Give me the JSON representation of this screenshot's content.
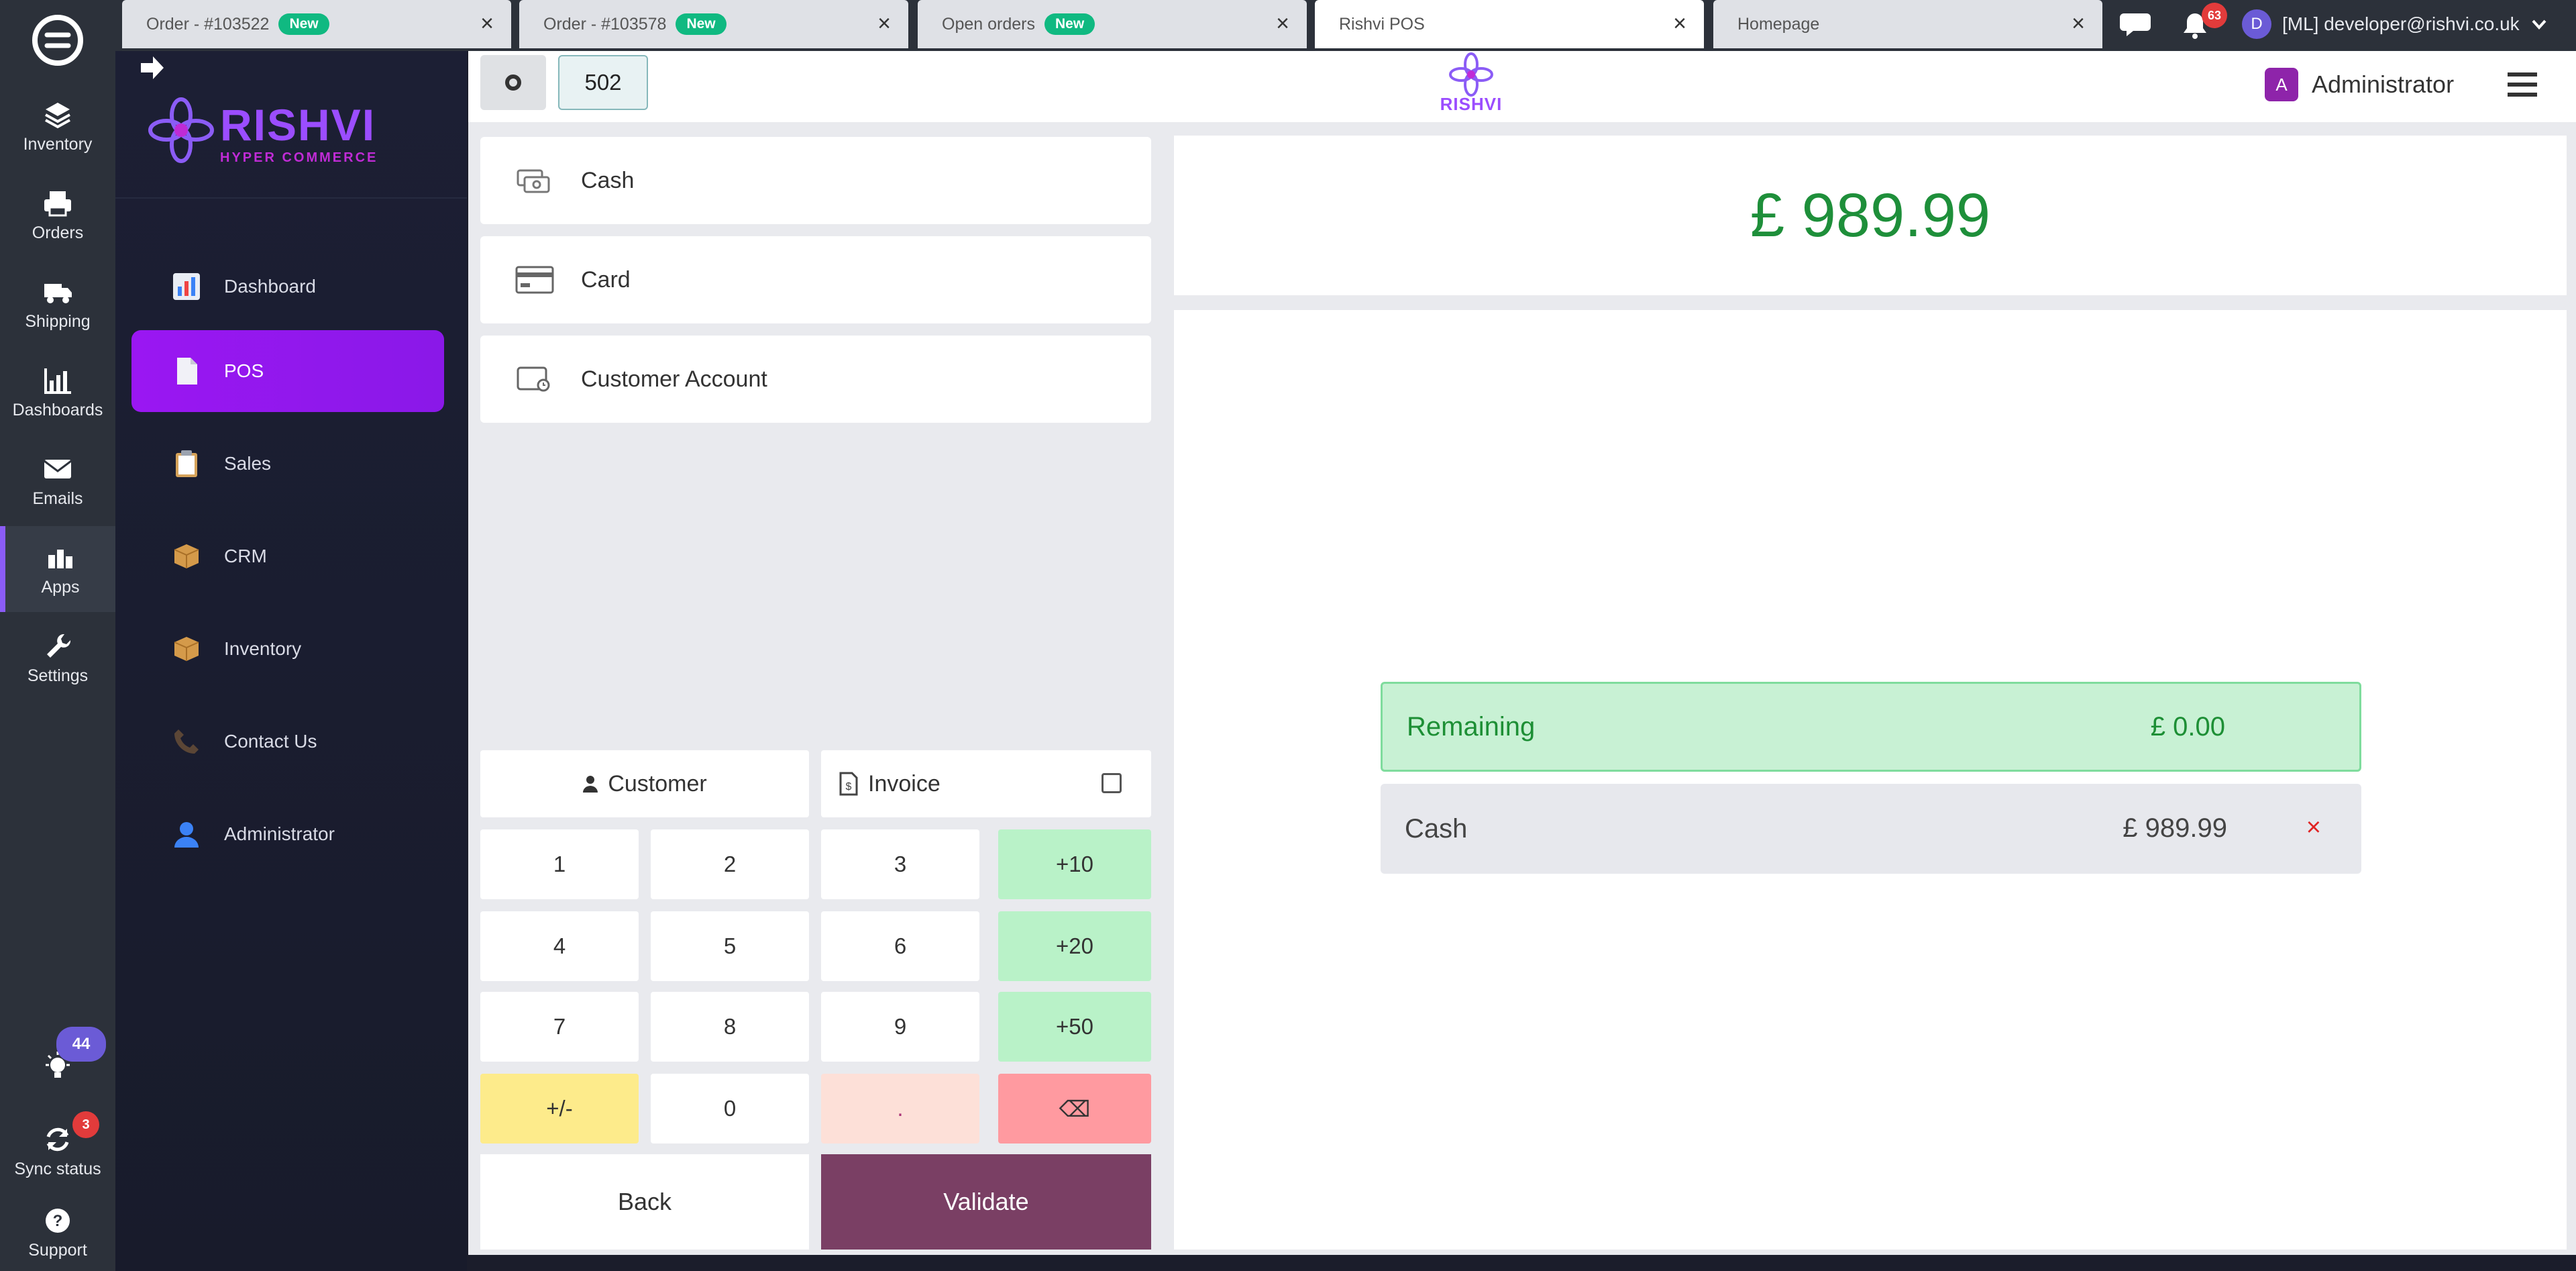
{
  "rail": {
    "items": [
      {
        "label": "Inventory",
        "icon": "layers-icon"
      },
      {
        "label": "Orders",
        "icon": "printer-icon"
      },
      {
        "label": "Shipping",
        "icon": "truck-icon"
      },
      {
        "label": "Dashboards",
        "icon": "bar-chart-icon"
      },
      {
        "label": "Emails",
        "icon": "envelope-icon"
      },
      {
        "label": "Apps",
        "icon": "apps-icon"
      },
      {
        "label": "Settings",
        "icon": "wrench-icon"
      }
    ],
    "bottom": {
      "tips_badge": "44",
      "sync_label": "Sync status",
      "sync_badge": "3",
      "support_label": "Support"
    }
  },
  "tabs": [
    {
      "title": "Order - #103522",
      "badge": "New"
    },
    {
      "title": "Order - #103578",
      "badge": "New"
    },
    {
      "title": "Open orders",
      "badge": "New"
    },
    {
      "title": "Rishvi POS",
      "badge": ""
    },
    {
      "title": "Homepage",
      "badge": ""
    }
  ],
  "header": {
    "notifications_count": "63",
    "user_initial": "D",
    "user_label": "[ML] developer@rishvi.co.uk"
  },
  "sidenav": {
    "brand_name": "RISHVI",
    "brand_sub": "HYPER COMMERCE",
    "items": [
      {
        "label": "Dashboard",
        "icon": "chart-icon"
      },
      {
        "label": "POS",
        "icon": "document-icon"
      },
      {
        "label": "Sales",
        "icon": "clipboard-icon"
      },
      {
        "label": "CRM",
        "icon": "package-icon"
      },
      {
        "label": "Inventory",
        "icon": "box-icon"
      },
      {
        "label": "Contact Us",
        "icon": "phone-icon"
      },
      {
        "label": "Administrator",
        "icon": "user-icon"
      }
    ],
    "active": "POS"
  },
  "pos": {
    "order_number": "502",
    "logo_text": "RISHVI",
    "admin_initial": "A",
    "admin_label": "Administrator",
    "payment_methods": [
      "Cash",
      "Card",
      "Customer Account"
    ],
    "customer_label": "Customer",
    "invoice_label": "Invoice",
    "keys": [
      [
        "1",
        "2",
        "3",
        "+10"
      ],
      [
        "4",
        "5",
        "6",
        "+20"
      ],
      [
        "7",
        "8",
        "9",
        "+50"
      ],
      [
        "+/-",
        "0",
        ".",
        "⌫"
      ]
    ],
    "back_label": "Back",
    "validate_label": "Validate",
    "total": "£ 989.99",
    "remaining_label": "Remaining",
    "remaining_amount": "£ 0.00",
    "payment_lines": [
      {
        "method": "Cash",
        "amount": "£ 989.99",
        "remove": "×"
      }
    ]
  },
  "colors": {
    "accent": "#9a17f2",
    "total_green": "#1e8f3a",
    "validate": "#7a3f64"
  }
}
